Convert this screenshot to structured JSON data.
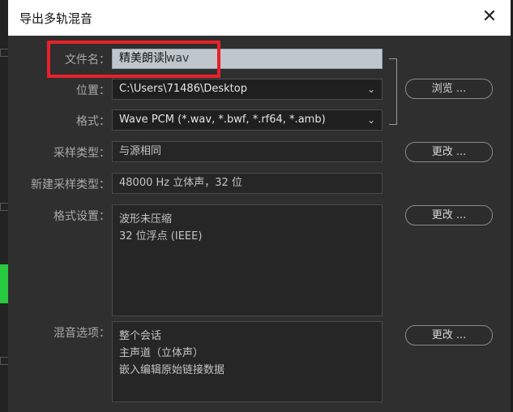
{
  "dialog": {
    "title": "导出多轨混音",
    "close_symbol": "✕"
  },
  "filename": {
    "label": "文件名：",
    "value": "精美朗读",
    "extension": "wav"
  },
  "location": {
    "label": "位置：",
    "value": "C:\\Users\\71486\\Desktop",
    "browse_label": "浏览 ..."
  },
  "format": {
    "label": "格式：",
    "value": "Wave PCM (*.wav, *.bwf, *.rf64, *.amb)"
  },
  "sample_type": {
    "label": "采样类型：",
    "value": "与源相同",
    "change_label": "更改 ..."
  },
  "new_sample_type": {
    "label": "新建采样类型：",
    "value": "48000 Hz 立体声，32 位"
  },
  "format_settings": {
    "label": "格式设置：",
    "lines": [
      "波形未压缩",
      "32 位浮点 (IEEE)"
    ],
    "change_label": "更改 ..."
  },
  "mix_options": {
    "label": "混音选项：",
    "lines": [
      "整个会话",
      "主声道（立体声）",
      "嵌入编辑原始链接数据"
    ],
    "change_label": "更改 ..."
  },
  "icons": [
    "close-icon",
    "chevron-down-icon"
  ],
  "colors": {
    "highlight_box": "#e8202a",
    "filename_bg": "#bfc6cc",
    "dialog_bg": "#2f2f2f"
  }
}
